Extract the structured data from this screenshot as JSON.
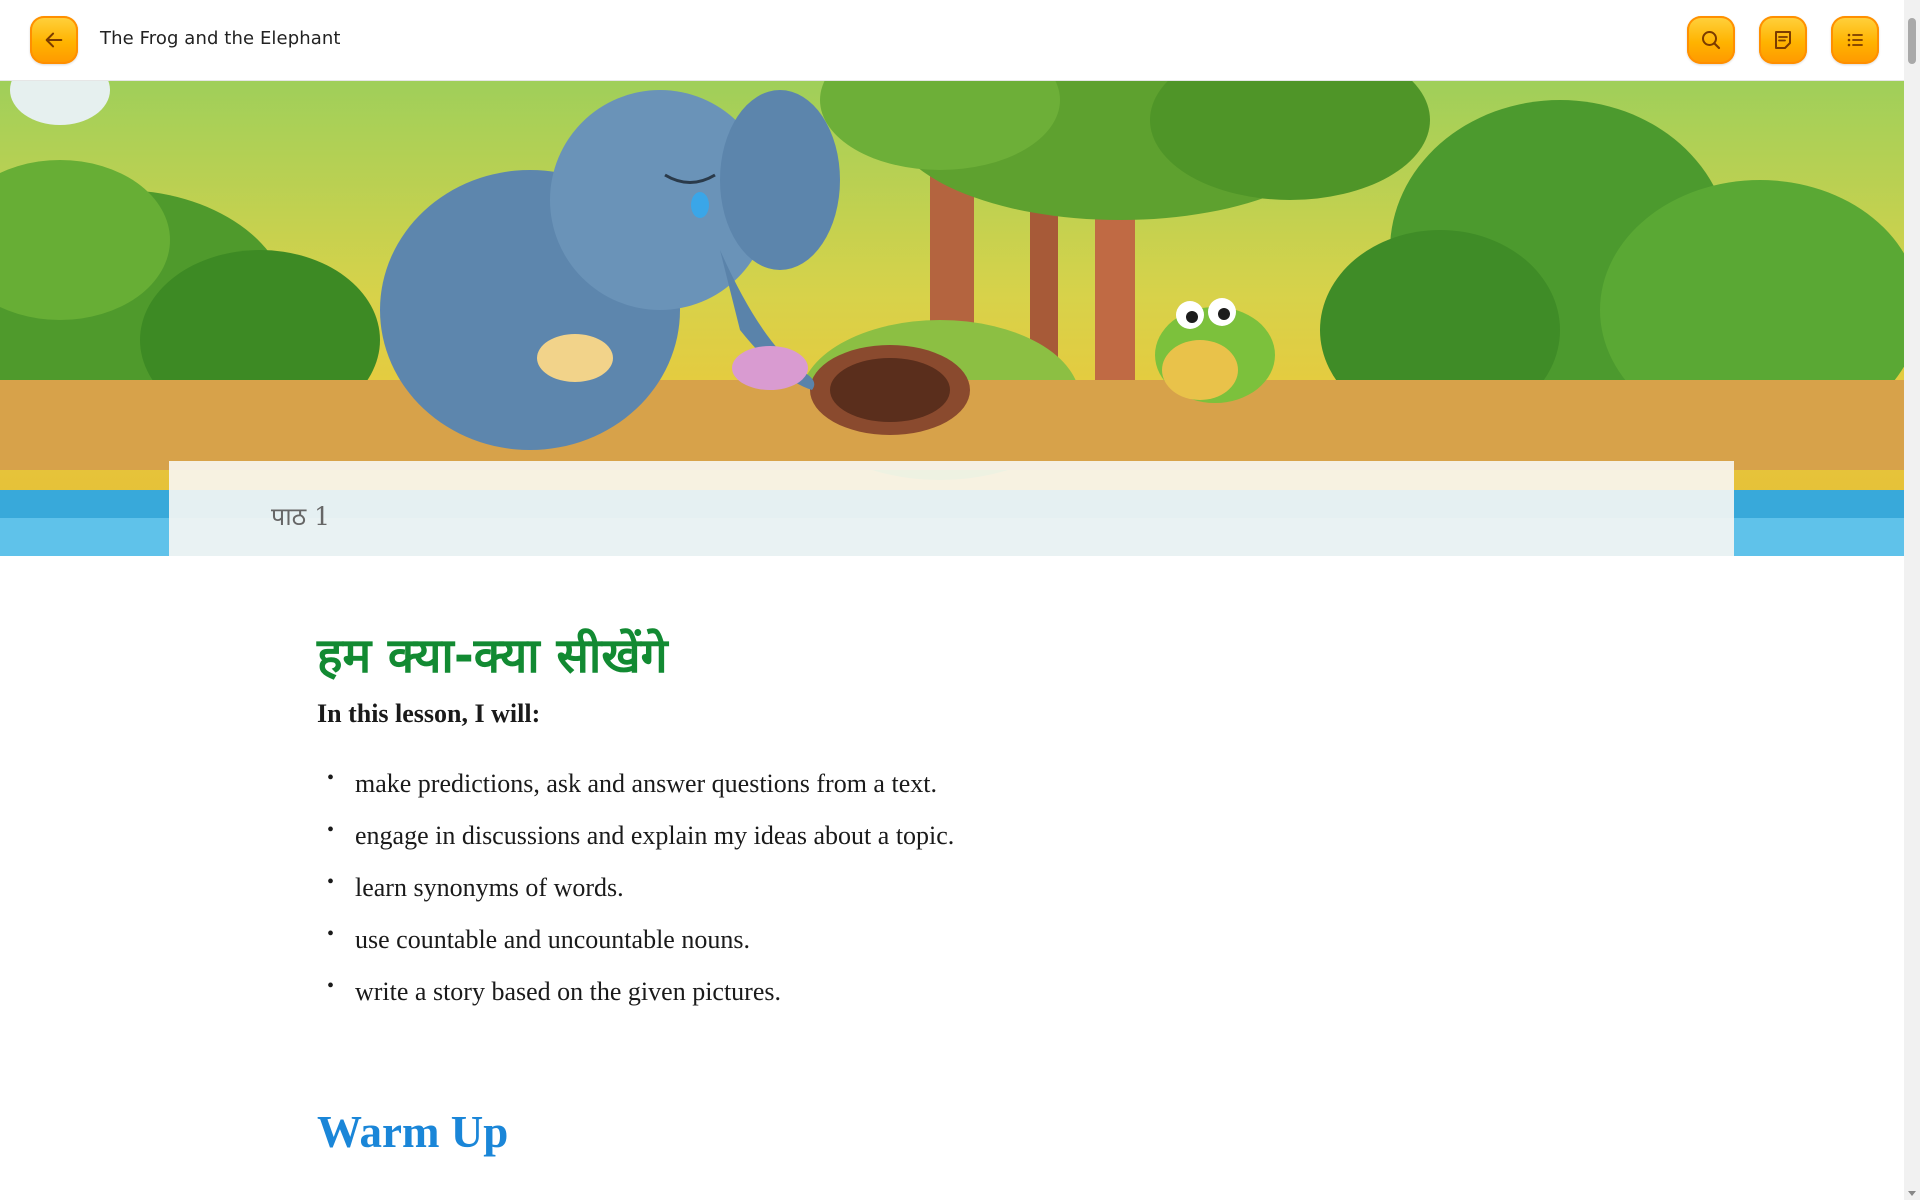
{
  "topbar": {
    "back_icon": "arrow-left-icon",
    "title": "The Frog and the Elephant",
    "search_icon": "search-icon",
    "notes_icon": "notes-icon",
    "toc_icon": "list-icon",
    "button_color": "#ffb300"
  },
  "hero": {
    "lesson_number": "पाठ 1",
    "lesson_title": "The Frog and the Elephant"
  },
  "content": {
    "hindi_heading": "हम क्या-क्या सीखेंगे",
    "intro": "In this lesson, I will:",
    "goals": [
      "make predictions, ask and answer questions from a text.",
      "engage in discussions and explain my ideas about a topic.",
      "learn synonyms of words.",
      "use countable and uncountable nouns.",
      "write a story based on the given pictures."
    ],
    "section_heading": "Warm Up"
  },
  "colors": {
    "title_blue": "#2ab0ee",
    "heading_green": "#128a32",
    "section_blue": "#1a86d8"
  }
}
